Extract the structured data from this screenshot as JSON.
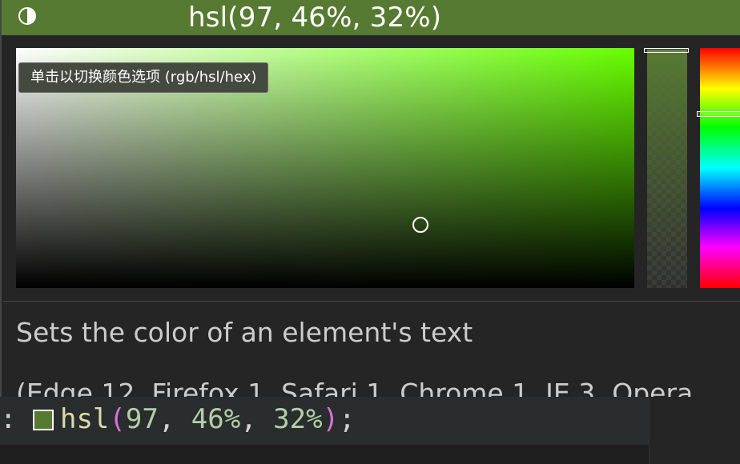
{
  "color_picker": {
    "header_value": "hsl(97, 46%, 32%)",
    "header_color": "#577a33",
    "tooltip": "单击以切换颜色选项 (rgb/hsl/hex)",
    "hue_color": "#66ff00",
    "contrast_icon": "contrast-icon"
  },
  "hover": {
    "description": "Sets the color of an element's text",
    "compatibility": "(Edge 12, Firefox 1, Safari 1, Chrome 1, IE 3, Opera"
  },
  "editor": {
    "colon": ":",
    "function_name": "hsl",
    "open_paren": "(",
    "arg_hue": "97",
    "comma1": ", ",
    "arg_sat": "46%",
    "comma2": ", ",
    "arg_light": "32%",
    "close_paren": ")",
    "semicolon": ";",
    "swatch_color": "#577a33"
  }
}
